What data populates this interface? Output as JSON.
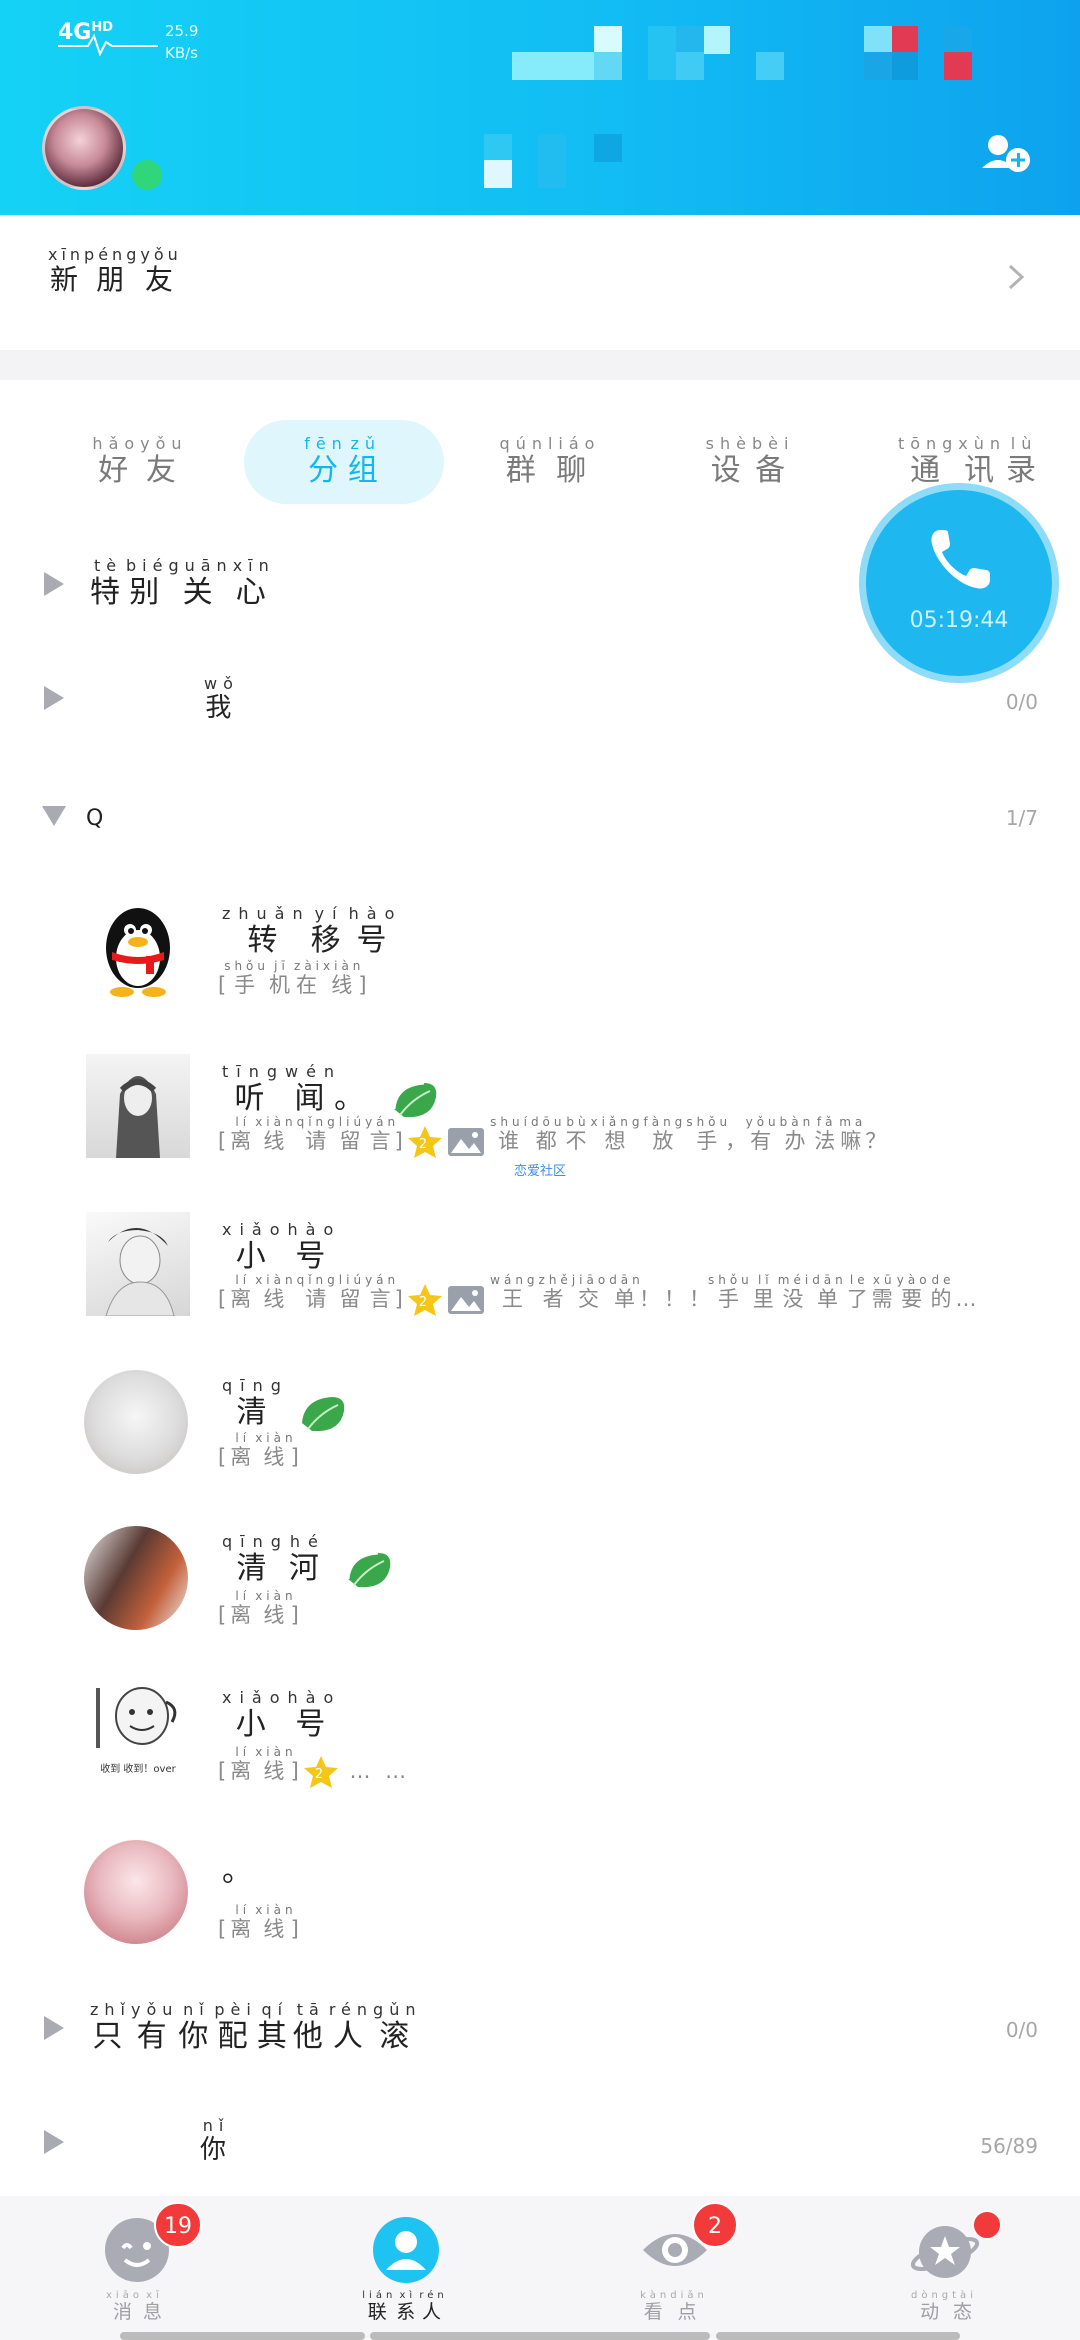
{
  "status_bar": {
    "network": "4G",
    "network_hd": "HD",
    "speed_value": "25.9",
    "speed_unit": "KB/s"
  },
  "new_friends": {
    "label": "新朋友",
    "pinyin": [
      "xīn",
      "péng",
      "yǒu"
    ],
    "chars": [
      "新",
      "朋",
      "友"
    ]
  },
  "tabs": [
    {
      "chars": [
        "好",
        "友"
      ],
      "pinyin": [
        "hǎo",
        "yǒu"
      ],
      "active": false
    },
    {
      "chars": [
        "分",
        "组"
      ],
      "pinyin": [
        "fēn",
        "zǔ"
      ],
      "active": true
    },
    {
      "chars": [
        "群",
        "聊"
      ],
      "pinyin": [
        "qún",
        "liáo"
      ],
      "active": false
    },
    {
      "chars": [
        "设",
        "备"
      ],
      "pinyin": [
        "shè",
        "bèi"
      ],
      "active": false
    },
    {
      "chars": [
        "通",
        "讯",
        "录"
      ],
      "pinyin": [
        "tōng",
        "xùn",
        "lù"
      ],
      "active": false
    }
  ],
  "call": {
    "timer": "05:19:44"
  },
  "groups": {
    "special": {
      "chars": [
        "特",
        "别",
        "关",
        "心"
      ],
      "pinyin": [
        "tè",
        "bié",
        "guān",
        "xīn"
      ]
    },
    "me": {
      "chars": [
        "我"
      ],
      "pinyin": [
        "wǒ"
      ],
      "count": "0/0"
    },
    "q": {
      "name": "Q",
      "count": "1/7"
    },
    "only": {
      "chars": [
        "只",
        "有",
        "你",
        "配",
        "其",
        "他",
        "人",
        "滚"
      ],
      "pinyin": [
        "zhǐ",
        "yǒu",
        "nǐ",
        "pèi",
        "qí",
        "tā",
        "rén",
        "gǔn"
      ],
      "count": "0/0"
    },
    "you": {
      "chars": [
        "你"
      ],
      "pinyin": [
        "nǐ"
      ],
      "count": "56/89"
    }
  },
  "contacts": [
    {
      "name_chars": [
        "转",
        "移",
        "号"
      ],
      "name_pinyin": [
        "zhuǎn",
        "yí",
        "hào"
      ],
      "status_chars": [
        "手",
        "机",
        "在",
        "线"
      ],
      "status_pinyin": [
        "shǒu",
        "jī",
        "zài",
        "xiàn"
      ]
    },
    {
      "name_chars": [
        "听",
        "闻",
        "。"
      ],
      "name_pinyin": [
        "tīng",
        "wén",
        ""
      ],
      "status_chars": [
        "离",
        "线",
        "请",
        "留",
        "言"
      ],
      "status_pinyin": [
        "lí",
        "xiàn",
        "qǐng",
        "liú",
        "yán"
      ],
      "message_chars": [
        "谁",
        "都",
        "不",
        "想",
        "放",
        "手",
        "，",
        "有",
        "办",
        "法",
        "嘛",
        "？"
      ],
      "message_pinyin": [
        "shuí",
        "dōu",
        "bù",
        "xiǎng",
        "fàng",
        "shǒu",
        "",
        "yǒu",
        "bàn",
        "fǎ",
        "ma",
        ""
      ],
      "community": "恋爱社区"
    },
    {
      "name_chars": [
        "小",
        "号"
      ],
      "name_pinyin": [
        "xiǎo",
        "hào"
      ],
      "status_chars": [
        "离",
        "线",
        "请",
        "留",
        "言"
      ],
      "status_pinyin": [
        "lí",
        "xiàn",
        "qǐng",
        "liú",
        "yán"
      ],
      "message_chars": [
        "王",
        "者",
        "交",
        "单",
        "！",
        "！",
        "！",
        "手",
        "里",
        "没",
        "单",
        "了",
        "需",
        "要",
        "的",
        "…"
      ],
      "message_pinyin": [
        "wáng",
        "zhě",
        "jiāo",
        "dān",
        "",
        "",
        "",
        "shǒu",
        "lǐ",
        "méi",
        "dān",
        "le",
        "xū",
        "yào",
        "de",
        ""
      ]
    },
    {
      "name_chars": [
        "清"
      ],
      "name_pinyin": [
        "qīng"
      ],
      "status_chars": [
        "离",
        "线"
      ],
      "status_pinyin": [
        "lí",
        "xiàn"
      ]
    },
    {
      "name_chars": [
        "清",
        "河"
      ],
      "name_pinyin": [
        "qīng",
        "hé"
      ],
      "status_chars": [
        "离",
        "线"
      ],
      "status_pinyin": [
        "lí",
        "xiàn"
      ]
    },
    {
      "name_chars": [
        "小",
        "号"
      ],
      "name_pinyin": [
        "xiǎo",
        "hào"
      ],
      "status_chars": [
        "离",
        "线"
      ],
      "status_pinyin": [
        "lí",
        "xiàn"
      ],
      "message": "… …",
      "avatar_caption": "收到 收到！over"
    },
    {
      "name": "。",
      "status_chars": [
        "离",
        "线"
      ],
      "status_pinyin": [
        "lí",
        "xiàn"
      ]
    }
  ],
  "bottom_nav": [
    {
      "chars": [
        "消",
        "息"
      ],
      "pinyin": [
        "xiāo",
        "xī"
      ],
      "badge": "19",
      "active": false
    },
    {
      "chars": [
        "联",
        "系",
        "人"
      ],
      "pinyin": [
        "lián",
        "xì",
        "rén"
      ],
      "active": true
    },
    {
      "chars": [
        "看",
        "点"
      ],
      "pinyin": [
        "kàn",
        "diǎn"
      ],
      "badge": "2",
      "active": false
    },
    {
      "chars": [
        "动",
        "态"
      ],
      "pinyin": [
        "dòng",
        "tài"
      ],
      "active": false
    }
  ],
  "colors": {
    "header_start": "#14d2f5",
    "header_end": "#0ea2ee",
    "accent": "#12b7ec",
    "badge": "#f23a3a",
    "online": "#2fd67a"
  }
}
